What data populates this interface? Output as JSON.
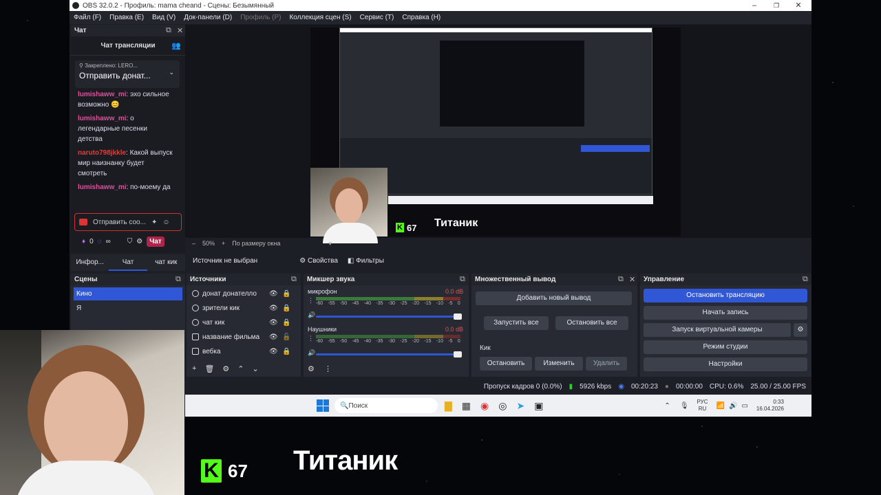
{
  "window": {
    "title": "OBS 32.0.2 - Профиль: mama cheand - Сцены: Безымянный",
    "minimize": "–",
    "maximize": "❐",
    "close": "✕"
  },
  "menu": [
    "Файл (F)",
    "Правка (E)",
    "Вид (V)",
    "Док-панели (D)",
    "Профиль (P)",
    "Коллекция сцен (S)",
    "Сервис (T)",
    "Справка (H)"
  ],
  "chat": {
    "dock_title": "Чат",
    "header": "Чат трансляции",
    "pinned_label": "Закреплено:",
    "pinned_by": "LERO...",
    "pinned_text": "Отправить донат...",
    "messages": [
      {
        "name": "lumishaww_mi",
        "text": "эхо сильное возможно 😊",
        "color": "#e84a9e"
      },
      {
        "name": "lumishaww_mi",
        "text": "о легендарные песенки детства",
        "color": "#e84a9e"
      },
      {
        "name": "naruto798jkkle",
        "text": "Какой выпуск мир наизнанку будет смотреть",
        "color": "#e23c3c"
      },
      {
        "name": "lumishaww_mi",
        "text": "по-моему да",
        "color": "#e84a9e"
      }
    ],
    "input_placeholder": "Отправить соо...",
    "points": "0",
    "infinity": "∞",
    "chat_button": "Чат"
  },
  "dock_tabs": [
    "Инфор...",
    "Чат",
    "чат кик"
  ],
  "preview": {
    "zoom": "50%",
    "fit_label": "По размеру окна",
    "minus": "–",
    "plus": "+"
  },
  "overlay": {
    "k_count": "67",
    "title": "Титаник"
  },
  "source_bar": {
    "no_source": "Источник не выбран",
    "properties": "Свойства",
    "filters": "Фильтры"
  },
  "scenes": {
    "title": "Сцены",
    "items": [
      "Кино",
      "Я"
    ]
  },
  "sources": {
    "title": "Источники",
    "items": [
      "донат донателло",
      "зрители кик",
      "чат кик",
      "название фильма",
      "вебка"
    ]
  },
  "mixer": {
    "title": "Микшер звука",
    "channels": [
      {
        "name": "микрофон",
        "db": "0.0 dB"
      },
      {
        "name": "Наушники",
        "db": "0.0 dB"
      }
    ],
    "ticks": [
      "-60",
      "-55",
      "-50",
      "-45",
      "-40",
      "-35",
      "-30",
      "-25",
      "-20",
      "-15",
      "-10",
      "-5",
      "0"
    ]
  },
  "multi_output": {
    "title": "Множественный вывод",
    "add": "Добавить новый вывод",
    "start_all": "Запустить все",
    "stop_all": "Остановить все",
    "target": "Кик",
    "stop": "Остановить",
    "edit": "Изменить",
    "delete": "Удалить"
  },
  "controls": {
    "title": "Управление",
    "stop_stream": "Остановить трансляцию",
    "start_record": "Начать запись",
    "virtual_cam": "Запуск виртуальной камеры",
    "studio_mode": "Режим студии",
    "settings": "Настройки"
  },
  "status": {
    "dropped": "Пропуск кадров 0 (0.0%)",
    "bitrate": "5926 kbps",
    "stream_time": "00:20:23",
    "record_time": "00:00:00",
    "cpu": "CPU: 0.6%",
    "fps": "25.00 / 25.00 FPS"
  },
  "taskbar": {
    "search": "Поиск",
    "lang1": "РУС",
    "lang2": "RU",
    "time": "0:33",
    "date": "16.04.2026",
    "obs": "OBS",
    "start_bar": "Start"
  },
  "colors": {
    "accent": "#2f57d6",
    "kick": "#53fc18",
    "panel": "#272a33"
  }
}
